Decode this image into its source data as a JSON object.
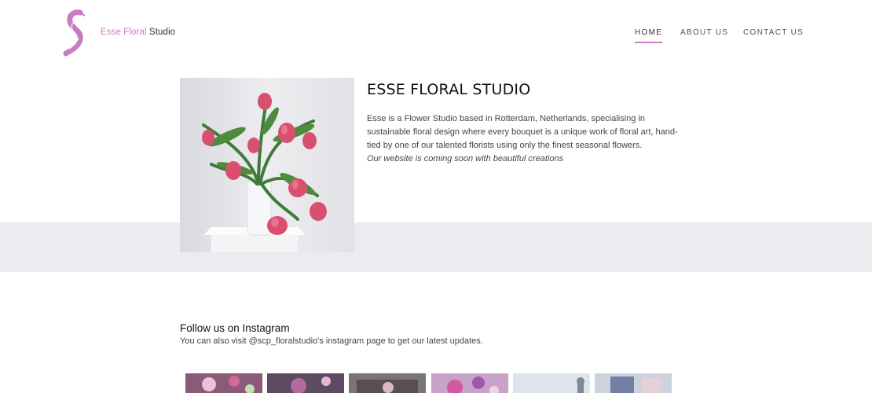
{
  "brand": {
    "name_part1": "Esse Floral",
    "name_part2": "Studio",
    "accent": "#c77bc4"
  },
  "nav": {
    "items": [
      {
        "label": "HOME",
        "active": true
      },
      {
        "label": "ABOUT US",
        "active": false
      },
      {
        "label": "CONTACT US",
        "active": false
      }
    ]
  },
  "intro": {
    "title": "ESSE FLORAL STUDIO",
    "body": "Esse is a Flower Studio based in Rotterdam, Netherlands, specialising in sustainable floral design where every bouquet is a unique work of floral art, hand-tied by one of our talented florists using only the finest seasonal flowers.",
    "note": "Our website is coming soon with beautiful creations"
  },
  "instagram": {
    "heading": "Follow us on Instagram",
    "subtext": "You can also visit @scp_floralstudio's instagram page to get our latest updates."
  },
  "colors": {
    "band": "#ebecf0",
    "text": "#333333"
  }
}
